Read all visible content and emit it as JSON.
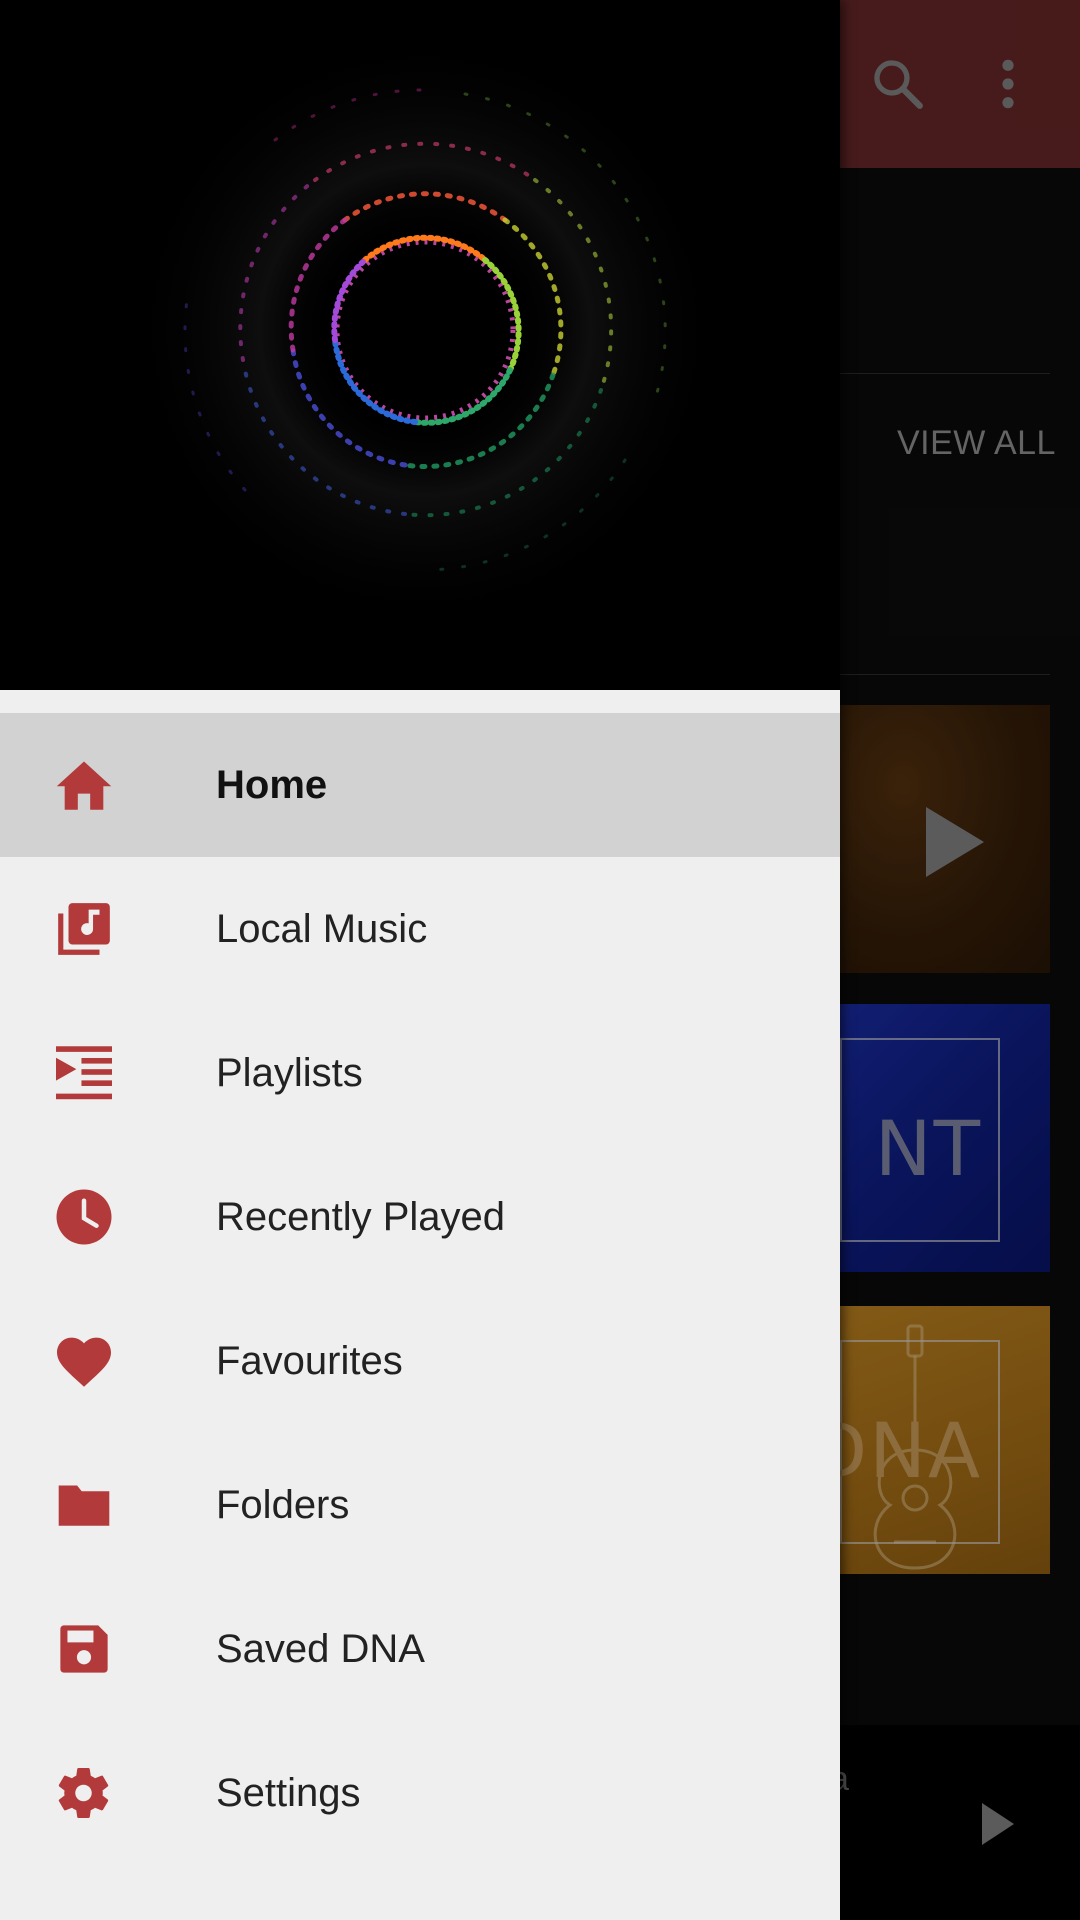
{
  "colors": {
    "accent": "#b33a3a",
    "appbar": "#6e2a2a",
    "drawer_bg": "#efefef",
    "active_item_bg": "#d2d2d2"
  },
  "toolbar": {
    "search_icon": "search-icon",
    "more_icon": "more-vertical-icon"
  },
  "background": {
    "view_all_label": "VIEW ALL",
    "card_texts": [
      "NT",
      "DNA"
    ],
    "mini_player_text": "a"
  },
  "drawer": {
    "header_image": "audio-visualizer-ring",
    "items": [
      {
        "label": "Home",
        "icon": "home-icon",
        "active": true
      },
      {
        "label": "Local Music",
        "icon": "library-music-icon",
        "active": false
      },
      {
        "label": "Playlists",
        "icon": "playlist-icon",
        "active": false
      },
      {
        "label": "Recently Played",
        "icon": "clock-icon",
        "active": false
      },
      {
        "label": "Favourites",
        "icon": "heart-icon",
        "active": false
      },
      {
        "label": "Folders",
        "icon": "folder-icon",
        "active": false
      },
      {
        "label": "Saved DNA",
        "icon": "save-icon",
        "active": false
      },
      {
        "label": "Settings",
        "icon": "gear-icon",
        "active": false
      }
    ]
  }
}
